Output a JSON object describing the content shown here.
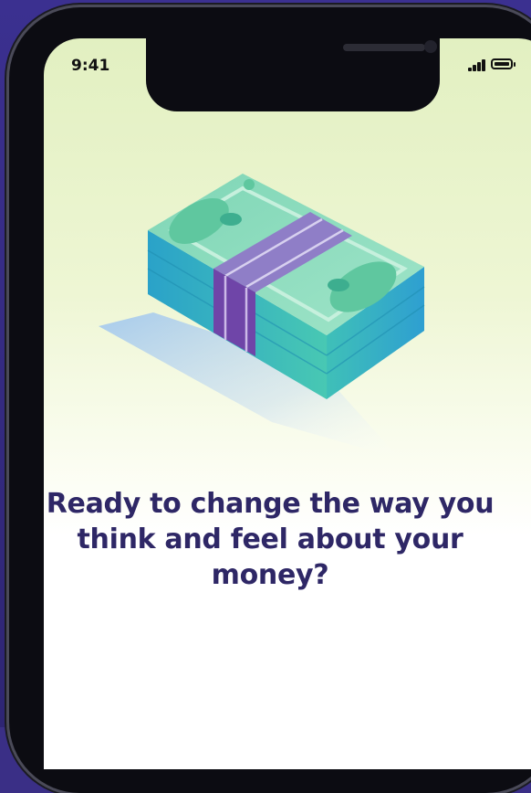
{
  "status_bar": {
    "time": "9:41",
    "signal_icon": "cellular-signal-icon",
    "battery_icon": "battery-icon"
  },
  "illustration": {
    "icon": "money-stack-icon",
    "colors": {
      "bill_top": "#8fdcc0",
      "bill_side": "#3cb7c9",
      "band": "#8d6ec6",
      "band_dark": "#6b3fa3"
    }
  },
  "onboarding": {
    "headline": "Ready to change the way you think and feel about your money?"
  },
  "colors": {
    "background": "#3a2f86",
    "headline": "#2e2766",
    "screen_top": "#e2f0c1",
    "screen_bottom": "#ffffff"
  }
}
